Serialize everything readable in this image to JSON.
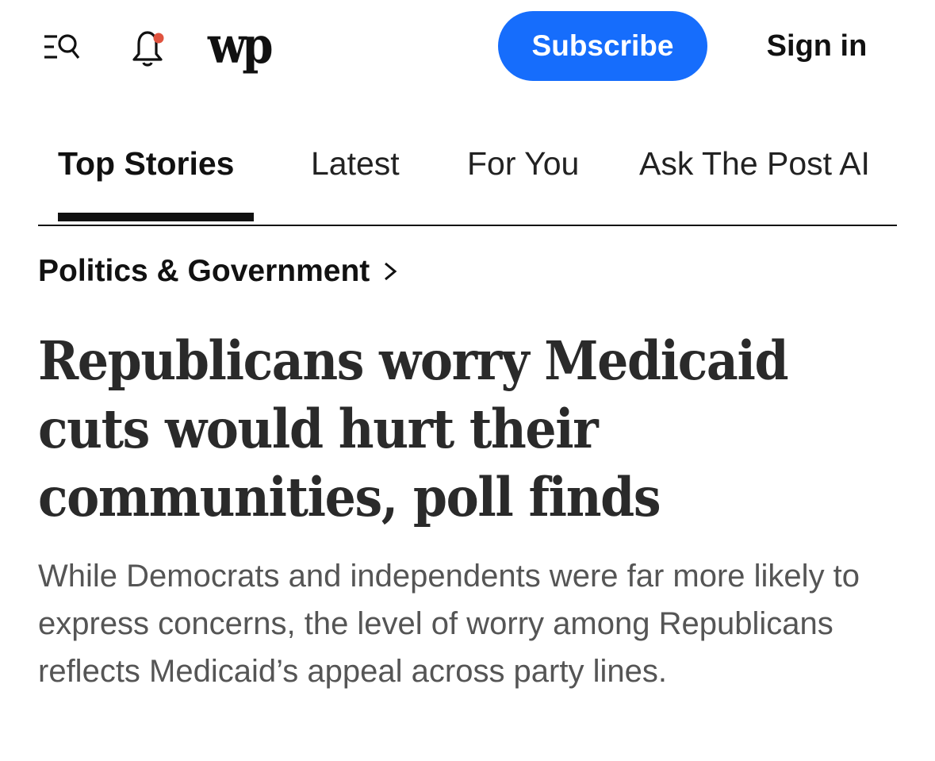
{
  "header": {
    "logo_text": "wp",
    "subscribe_label": "Subscribe",
    "signin_label": "Sign in",
    "icons": {
      "menu_search": "menu-search-icon",
      "notifications": "bell-icon",
      "notification_dot_color": "#e0533f"
    },
    "accent_color": "#166dfc"
  },
  "tabs": [
    {
      "label": "Top Stories",
      "active": true
    },
    {
      "label": "Latest",
      "active": false
    },
    {
      "label": "For You",
      "active": false
    },
    {
      "label": "Ask The Post AI",
      "active": false
    }
  ],
  "article": {
    "section": "Politics & Government",
    "headline": "Republicans worry Medicaid cuts would hurt their communities, poll finds",
    "dek": "While Democrats and independents were far more likely to express concerns, the level of worry among Republicans reflects Medicaid’s appeal across party lines."
  }
}
